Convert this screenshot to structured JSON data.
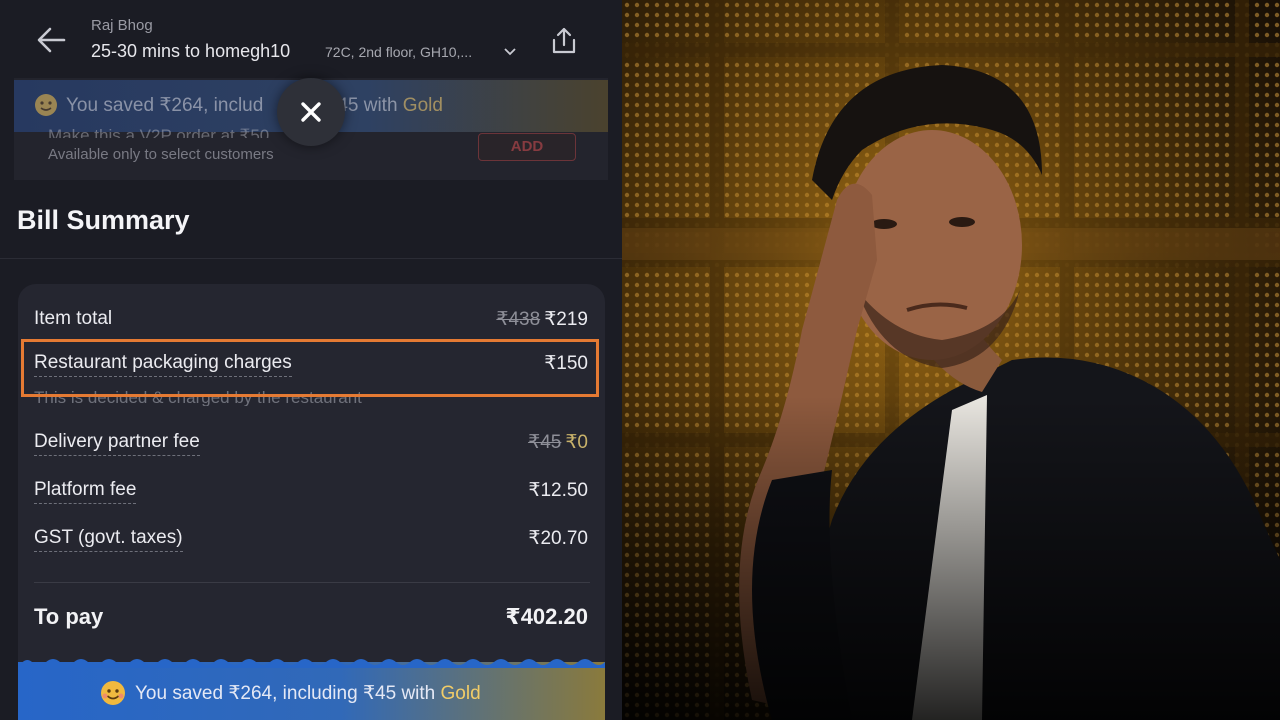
{
  "header": {
    "restaurant_name": "Raj Bhog",
    "eta": "25-30 mins to homegh10",
    "address": "72C, 2nd floor, GH10,...",
    "back_icon": "back-arrow-icon",
    "share_icon": "share-icon"
  },
  "overlay": {
    "gold_strip_prefix": "You saved ₹264, includ",
    "gold_strip_suffix": "45 with ",
    "gold_strip_gold": "Gold",
    "offer_title": "Make this a V2P order at ₹50",
    "offer_subtitle": "Available only to select customers",
    "add_label": "ADD",
    "close_icon": "close-icon"
  },
  "bill": {
    "title": "Bill Summary",
    "rows": [
      {
        "label": "Item total",
        "original": "₹438",
        "value": "₹219"
      },
      {
        "label": "Restaurant packaging charges",
        "value": "₹150",
        "note": "This is decided & charged by the restaurant"
      },
      {
        "label": "Delivery partner fee",
        "original": "₹45",
        "value": "₹0"
      },
      {
        "label": "Platform fee",
        "value": "₹12.50"
      },
      {
        "label": "GST (govt. taxes)",
        "value": "₹20.70"
      }
    ],
    "to_pay_label": "To pay",
    "to_pay_value": "₹402.20"
  },
  "savings": {
    "text": "You saved ₹264, including ₹45 with ",
    "gold": "Gold",
    "icon": "smiley-icon"
  },
  "colors": {
    "highlight": "#e57a33",
    "gold": "#f1cc68",
    "background": "#1b1c24",
    "card": "#252630"
  }
}
